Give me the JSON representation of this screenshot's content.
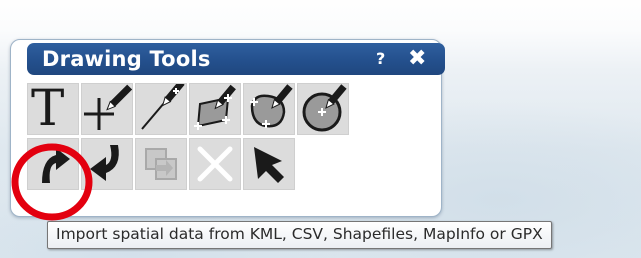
{
  "panel": {
    "title": "Drawing Tools",
    "help_label": "?",
    "close_label": "✖"
  },
  "tools": {
    "row1": [
      {
        "name": "text-tool",
        "icon": "text-icon",
        "glyph": "T"
      },
      {
        "name": "add-point-tool",
        "icon": "point-plus-icon"
      },
      {
        "name": "draw-line-tool",
        "icon": "pencil-line-icon"
      },
      {
        "name": "draw-polygon-tool",
        "icon": "pencil-polygon-icon"
      },
      {
        "name": "draw-freehand-area-tool",
        "icon": "pencil-area-icon"
      },
      {
        "name": "draw-circle-tool",
        "icon": "pencil-circle-icon"
      }
    ],
    "row2": [
      {
        "name": "import-tool",
        "icon": "import-arrow-icon",
        "state": "highlighted"
      },
      {
        "name": "export-tool",
        "icon": "export-arrow-icon"
      },
      {
        "name": "copy-layer-tool",
        "icon": "copy-icon",
        "state": "disabled"
      },
      {
        "name": "delete-tool",
        "icon": "x-icon",
        "state": "disabled"
      },
      {
        "name": "select-tool",
        "icon": "cursor-arrow-icon"
      }
    ]
  },
  "tooltip": {
    "text": "Import spatial data from KML, CSV, Shapefiles, MapInfo or GPX"
  },
  "colors": {
    "titlebar": "#24508d",
    "highlight": "#e3000f",
    "tool_bg": "#dcdcdc"
  }
}
